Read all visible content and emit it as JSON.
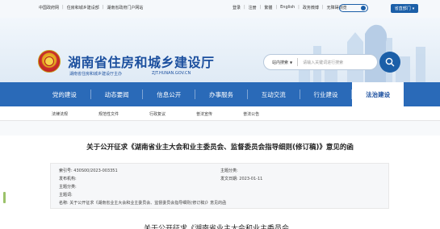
{
  "topbar": {
    "left_links": [
      "中国政府网",
      "住房和城乡建设部",
      "湖南省政府门户网站"
    ],
    "right_links": [
      "登录",
      "注册",
      "繁體",
      "English",
      "政务微博",
      "无障碍浏览"
    ],
    "province_button": "省直部门"
  },
  "header": {
    "title": "湖南省住房和城乡建设厅",
    "subtitle": "湖南省住房和城乡建设厅主办",
    "url": "ZJT.HUNAN.GOV.CN",
    "search_scope": "站内搜索",
    "search_placeholder": "请输入关键词进行搜索"
  },
  "nav": {
    "items": [
      {
        "label": "党的建设",
        "active": false
      },
      {
        "label": "动态要闻",
        "active": false
      },
      {
        "label": "信息公开",
        "active": false
      },
      {
        "label": "办事服务",
        "active": false
      },
      {
        "label": "互动交流",
        "active": false
      },
      {
        "label": "行业建设",
        "active": false
      },
      {
        "label": "法治建设",
        "active": true
      }
    ]
  },
  "subnav": {
    "items": [
      "法律法规",
      "规范性文件",
      "行政复议",
      "普法宣传",
      "普法公告"
    ]
  },
  "article": {
    "title": "关于公开征求《湖南省业主大会和业主委员会、监督委员会指导细则(修订稿)》意见的函",
    "meta": {
      "index_label": "索引号:",
      "index_value": "430S00/2023-003351",
      "category_label": "主题分类:",
      "category_value": "",
      "issuer_label": "发布机构:",
      "issuer_value": "",
      "date_label": "发文日期:",
      "date_value": "2023-01-11",
      "topic_label": "主题分类:",
      "topic_value": "",
      "keywords_label": "主题词:",
      "keywords_value": "",
      "name_label": "名称:",
      "name_value": "关于公开征求《湖南省业主大会和业主委员会、监督委员会指导细则(修订稿)》意见的函"
    },
    "body_first_line": "关于公开征求《湖南省业主大会和业主委员会、"
  },
  "colors": {
    "brand_blue": "#1b4f9e",
    "nav_blue": "#2a6ab8",
    "button_blue": "#1b5fa8"
  }
}
